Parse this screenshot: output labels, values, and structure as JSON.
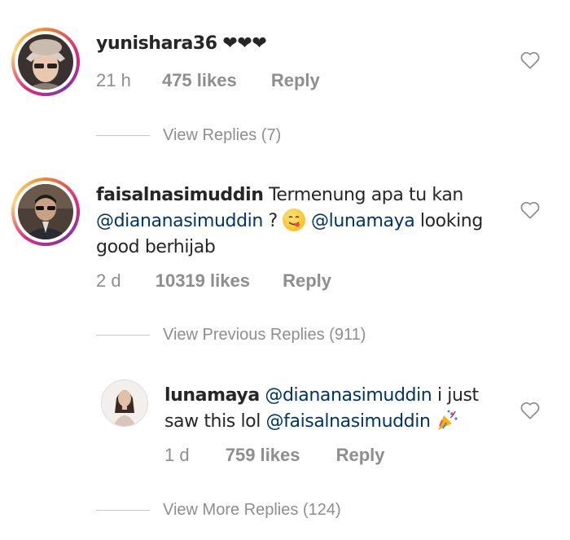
{
  "comments": [
    {
      "username": "yunishara36",
      "hearts": "❤❤❤",
      "time": "21 h",
      "likes": "475 likes",
      "reply": "Reply",
      "view_replies": "View Replies (7)"
    },
    {
      "username": "faisalnasimuddin",
      "text_1": "Termenung apa tu kan",
      "mention_1": "@diananasimuddin",
      "text_2": "?",
      "mention_2": "@lunamaya",
      "text_3": "looking good berhijab",
      "time": "2 d",
      "likes": "10319 likes",
      "reply": "Reply",
      "view_replies": "View Previous Replies (911)"
    },
    {
      "username": "lunamaya",
      "mention_1": "@diananasimuddin",
      "text_1": "i just saw this lol",
      "mention_2": "@faisalnasimuddin",
      "time": "1 d",
      "likes": "759 likes",
      "reply": "Reply",
      "view_replies": "View More Replies (124)"
    }
  ],
  "icons": {
    "like": "heart-outline-icon",
    "emoji_1": "yum-face-emoji",
    "emoji_2": "party-popper-emoji"
  },
  "colors": {
    "text": "#262626",
    "muted": "#8e8e8e",
    "mention": "#003569",
    "ring_start": "#f58529",
    "ring_end": "#dd2a7b"
  }
}
